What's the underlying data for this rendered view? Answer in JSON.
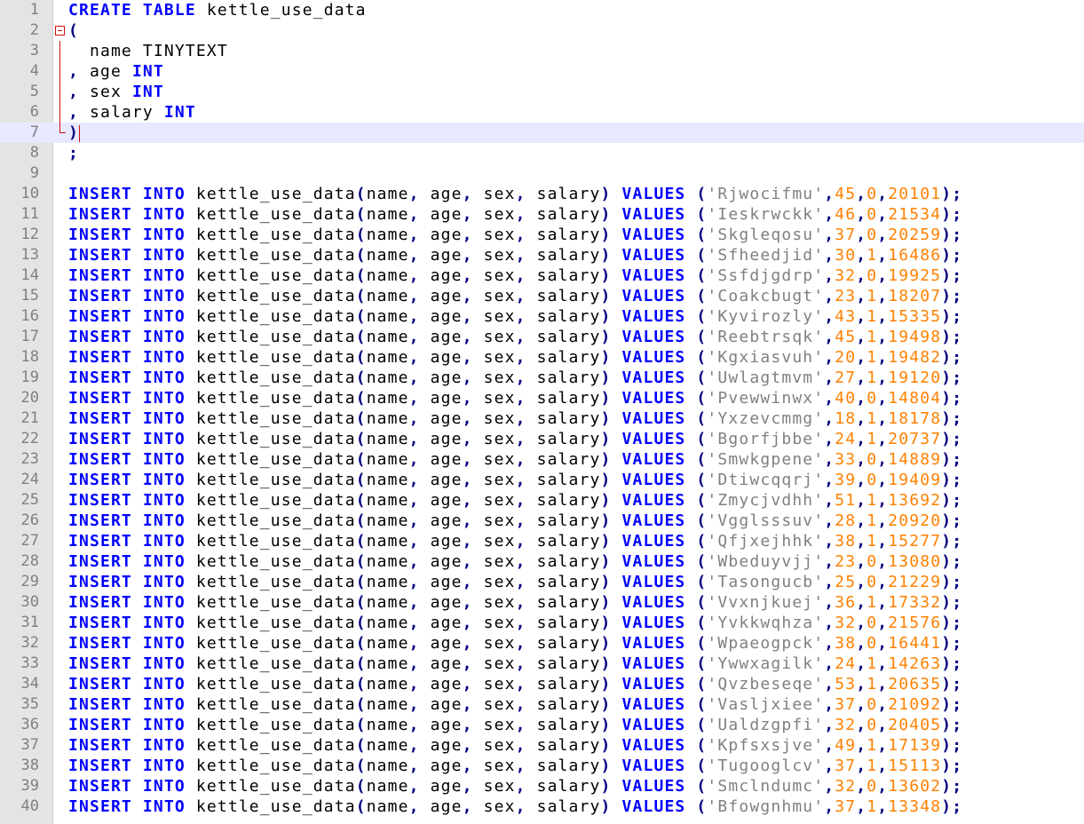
{
  "editor": {
    "colors": {
      "keyword": "#0000ff",
      "operator": "#000080",
      "string": "#808080",
      "number": "#ff8000",
      "current_line": "#e8e8ff",
      "gutter": "#e4e4e4",
      "fold_marker": "#d01010"
    },
    "current_line": 7,
    "fold_icon": "fold-minus-icon"
  },
  "header_lines": [
    {
      "n": "1",
      "tokens": [
        {
          "t": "CREATE",
          "c": "kw"
        },
        {
          "t": " ",
          "c": "id"
        },
        {
          "t": "TABLE",
          "c": "kw"
        },
        {
          "t": " kettle_use_data",
          "c": "id"
        }
      ]
    },
    {
      "n": "2",
      "tokens": [
        {
          "t": "(",
          "c": "op"
        }
      ]
    },
    {
      "n": "3",
      "tokens": [
        {
          "t": "  name TINYTEXT",
          "c": "id"
        }
      ]
    },
    {
      "n": "4",
      "tokens": [
        {
          "t": ",",
          "c": "op"
        },
        {
          "t": " age ",
          "c": "id"
        },
        {
          "t": "INT",
          "c": "kw"
        }
      ]
    },
    {
      "n": "5",
      "tokens": [
        {
          "t": ",",
          "c": "op"
        },
        {
          "t": " sex ",
          "c": "id"
        },
        {
          "t": "INT",
          "c": "kw"
        }
      ]
    },
    {
      "n": "6",
      "tokens": [
        {
          "t": ",",
          "c": "op"
        },
        {
          "t": " salary ",
          "c": "id"
        },
        {
          "t": "INT",
          "c": "kw"
        }
      ]
    },
    {
      "n": "7",
      "tokens": [
        {
          "t": ")",
          "c": "op"
        }
      ]
    },
    {
      "n": "8",
      "tokens": [
        {
          "t": ";",
          "c": "op"
        }
      ]
    },
    {
      "n": "9",
      "tokens": []
    }
  ],
  "insert_template": {
    "kw_insert": "INSERT",
    "kw_into": "INTO",
    "table_name": "kettle_use_data",
    "col_name": "name",
    "col_age": "age",
    "col_sex": "sex",
    "col_salary": "salary",
    "kw_values": "VALUES"
  },
  "rows": [
    {
      "n": "10",
      "name": "Rjwocifmu",
      "age": "45",
      "sex": "0",
      "salary": "20101"
    },
    {
      "n": "11",
      "name": "Ieskrwckk",
      "age": "46",
      "sex": "0",
      "salary": "21534"
    },
    {
      "n": "12",
      "name": "Skgleqosu",
      "age": "37",
      "sex": "0",
      "salary": "20259"
    },
    {
      "n": "13",
      "name": "Sfheedjid",
      "age": "30",
      "sex": "1",
      "salary": "16486"
    },
    {
      "n": "14",
      "name": "Ssfdjgdrp",
      "age": "32",
      "sex": "0",
      "salary": "19925"
    },
    {
      "n": "15",
      "name": "Coakcbugt",
      "age": "23",
      "sex": "1",
      "salary": "18207"
    },
    {
      "n": "16",
      "name": "Kyvirozly",
      "age": "43",
      "sex": "1",
      "salary": "15335"
    },
    {
      "n": "17",
      "name": "Reebtrsqk",
      "age": "45",
      "sex": "1",
      "salary": "19498"
    },
    {
      "n": "18",
      "name": "Kgxiasvuh",
      "age": "20",
      "sex": "1",
      "salary": "19482"
    },
    {
      "n": "19",
      "name": "Uwlagtmvm",
      "age": "27",
      "sex": "1",
      "salary": "19120"
    },
    {
      "n": "20",
      "name": "Pvewwinwx",
      "age": "40",
      "sex": "0",
      "salary": "14804"
    },
    {
      "n": "21",
      "name": "Yxzevcmmg",
      "age": "18",
      "sex": "1",
      "salary": "18178"
    },
    {
      "n": "22",
      "name": "Bgorfjbbe",
      "age": "24",
      "sex": "1",
      "salary": "20737"
    },
    {
      "n": "23",
      "name": "Smwkgpene",
      "age": "33",
      "sex": "0",
      "salary": "14889"
    },
    {
      "n": "24",
      "name": "Dtiwcqqrj",
      "age": "39",
      "sex": "0",
      "salary": "19409"
    },
    {
      "n": "25",
      "name": "Zmycjvdhh",
      "age": "51",
      "sex": "1",
      "salary": "13692"
    },
    {
      "n": "26",
      "name": "Vgglsssuv",
      "age": "28",
      "sex": "1",
      "salary": "20920"
    },
    {
      "n": "27",
      "name": "Qfjxejhhk",
      "age": "38",
      "sex": "1",
      "salary": "15277"
    },
    {
      "n": "28",
      "name": "Wbeduyvjj",
      "age": "23",
      "sex": "0",
      "salary": "13080"
    },
    {
      "n": "29",
      "name": "Tasongucb",
      "age": "25",
      "sex": "0",
      "salary": "21229"
    },
    {
      "n": "30",
      "name": "Vvxnjkuej",
      "age": "36",
      "sex": "1",
      "salary": "17332"
    },
    {
      "n": "31",
      "name": "Yvkkwqhza",
      "age": "32",
      "sex": "0",
      "salary": "21576"
    },
    {
      "n": "32",
      "name": "Wpaeogpck",
      "age": "38",
      "sex": "0",
      "salary": "16441"
    },
    {
      "n": "33",
      "name": "Ywwxagilk",
      "age": "24",
      "sex": "1",
      "salary": "14263"
    },
    {
      "n": "34",
      "name": "Qvzbeseqe",
      "age": "53",
      "sex": "1",
      "salary": "20635"
    },
    {
      "n": "35",
      "name": "Vasljxiee",
      "age": "37",
      "sex": "0",
      "salary": "21092"
    },
    {
      "n": "36",
      "name": "Ualdzgpfi",
      "age": "32",
      "sex": "0",
      "salary": "20405"
    },
    {
      "n": "37",
      "name": "Kpfsxsjve",
      "age": "49",
      "sex": "1",
      "salary": "17139"
    },
    {
      "n": "38",
      "name": "Tugooglcv",
      "age": "37",
      "sex": "1",
      "salary": "15113"
    },
    {
      "n": "39",
      "name": "Smclndumc",
      "age": "32",
      "sex": "0",
      "salary": "13602"
    },
    {
      "n": "40",
      "name": "Bfowgnhmu",
      "age": "37",
      "sex": "1",
      "salary": "13348"
    }
  ]
}
